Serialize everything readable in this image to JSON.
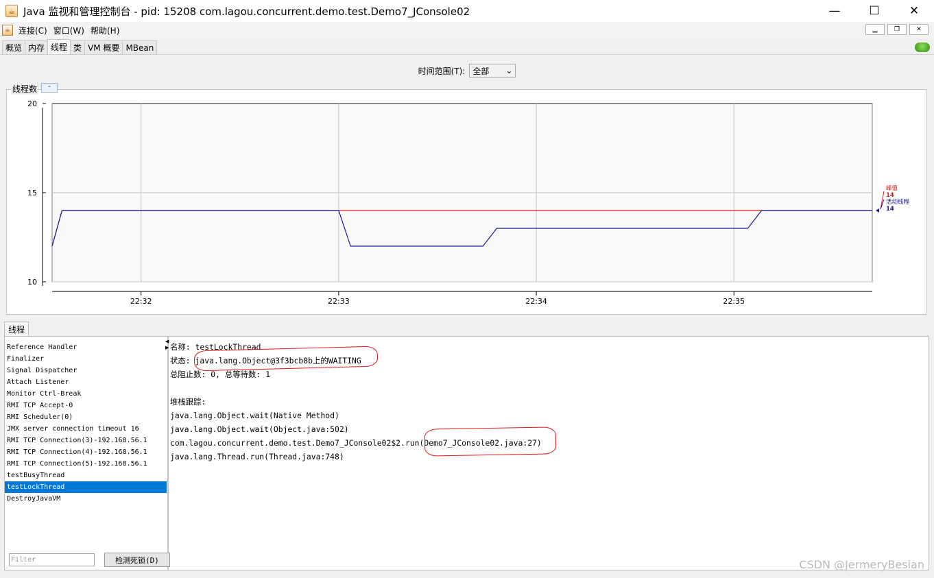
{
  "window": {
    "title": "Java 监视和管理控制台 - pid: 15208 com.lagou.concurrent.demo.test.Demo7_JConsole02",
    "controls": {
      "minimize": "—",
      "maximize": "☐",
      "close": "✕"
    }
  },
  "menu": {
    "items": [
      "连接(C)",
      "窗口(W)",
      "帮助(H)"
    ]
  },
  "tabs": [
    {
      "label": "概览",
      "active": false
    },
    {
      "label": "内存",
      "active": false
    },
    {
      "label": "线程",
      "active": true
    },
    {
      "label": "类",
      "active": false
    },
    {
      "label": "VM 概要",
      "active": false
    },
    {
      "label": "MBean",
      "active": false
    }
  ],
  "time_range": {
    "label": "时间范围(T):",
    "value": "全部"
  },
  "chart_section": {
    "title": "线程数"
  },
  "chart_data": {
    "type": "line",
    "title": "线程数",
    "x_ticks": [
      "22:32",
      "22:33",
      "22:34",
      "22:35"
    ],
    "x_range_minutes": [
      31.55,
      35.7
    ],
    "y_ticks": [
      10,
      15,
      20
    ],
    "ylim": [
      10,
      20
    ],
    "grid": true,
    "legend_placement": "right",
    "series": [
      {
        "name": "峰值",
        "color": "#d81b1b",
        "current_label": "14",
        "points": [
          [
            31.55,
            12
          ],
          [
            31.6,
            14
          ],
          [
            33.0,
            14
          ],
          [
            35.7,
            14
          ]
        ]
      },
      {
        "name": "活动线程",
        "color": "#1a1a9c",
        "current_label": "14",
        "points": [
          [
            31.55,
            12
          ],
          [
            31.6,
            14
          ],
          [
            33.0,
            14
          ],
          [
            33.06,
            12
          ],
          [
            33.73,
            12
          ],
          [
            33.8,
            13
          ],
          [
            35.07,
            13
          ],
          [
            35.14,
            14
          ],
          [
            35.7,
            14
          ]
        ]
      }
    ]
  },
  "threads_panel": {
    "tab_label": "线程",
    "threads": [
      "Reference Handler",
      "Finalizer",
      "Signal Dispatcher",
      "Attach Listener",
      "Monitor Ctrl-Break",
      "RMI TCP Accept-0",
      "RMI Scheduler(0)",
      "JMX server connection timeout 16",
      "RMI TCP Connection(3)-192.168.56.1",
      "RMI TCP Connection(4)-192.168.56.1",
      "RMI TCP Connection(5)-192.168.56.1",
      "testBusyThread",
      "testLockThread",
      "DestroyJavaVM"
    ],
    "selected": "testLockThread",
    "filter_placeholder": "Filter",
    "detect_button": "检测死锁(D)",
    "detail": {
      "name_line": "名称: testLockThread",
      "state_line": "状态: java.lang.Object@3f3bcb8b上的WAITING",
      "counts_line": "总阻止数: 0, 总等待数: 1",
      "blank": "",
      "stack_title": "堆栈跟踪:",
      "stack": [
        "java.lang.Object.wait(Native Method)",
        "java.lang.Object.wait(Object.java:502)",
        "com.lagou.concurrent.demo.test.Demo7_JConsole02$2.run(Demo7_JConsole02.java:27)",
        "java.lang.Thread.run(Thread.java:748)"
      ]
    }
  },
  "watermark": "CSDN @JermeryBesian"
}
